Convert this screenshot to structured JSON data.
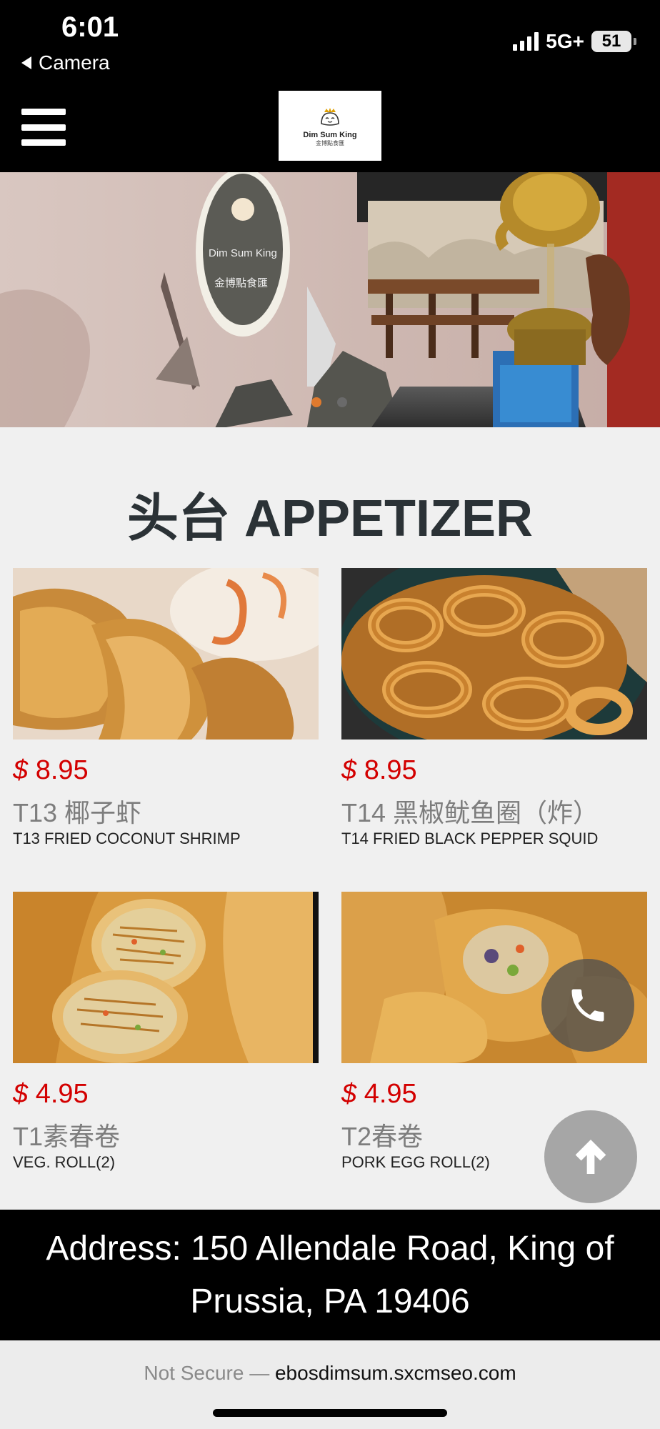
{
  "status_bar": {
    "time": "6:01",
    "back_label": "Camera",
    "network": "5G+",
    "battery": "51"
  },
  "header": {
    "logo_title": "Dim Sum King",
    "logo_subtitle": "金博點食匯"
  },
  "hero": {
    "slide_count": 2,
    "active_slide": 1,
    "accent_color": "#e07a2e"
  },
  "section": {
    "title": "头台 APPETIZER"
  },
  "menu_items": [
    {
      "price": "8.95",
      "currency": "$",
      "name_cn": "T13 椰子虾",
      "name_en": "T13 FRIED COCONUT SHRIMP"
    },
    {
      "price": "8.95",
      "currency": "$",
      "name_cn": "T14 黑椒鱿鱼圈（炸）",
      "name_en": "T14 FRIED BLACK PEPPER SQUID"
    },
    {
      "price": "4.95",
      "currency": "$",
      "name_cn": "T1素春卷",
      "name_en": "VEG. ROLL(2)"
    },
    {
      "price": "4.95",
      "currency": "$",
      "name_cn": "T2春卷",
      "name_en": "PORK EGG ROLL(2)"
    }
  ],
  "footer": {
    "address": "Address: 150 Allendale Road, King of Prussia, PA 19406"
  },
  "browser": {
    "security": "Not Secure —",
    "domain": "ebosdimsum.sxcmseo.com"
  },
  "colors": {
    "price_red": "#d30000",
    "title_dark": "#2b3236"
  }
}
